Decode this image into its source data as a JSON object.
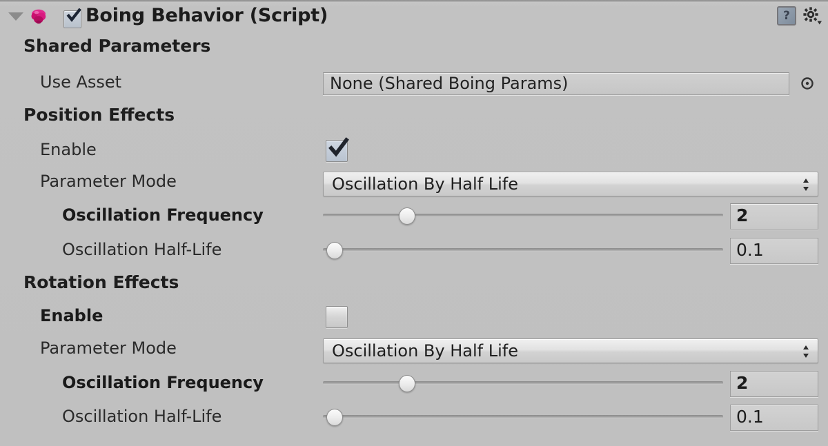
{
  "header": {
    "title": "Boing Behavior (Script)",
    "enabled_checkbox": true,
    "foldout_expanded": true,
    "script_icon": "unity-script-icon",
    "help_icon_glyph": "?",
    "gear_icon": "settings-gear-icon",
    "accent_color": "#d6197f",
    "panel_bg": "#c0c0c0"
  },
  "sections": {
    "shared_parameters": {
      "title": "Shared Parameters",
      "use_asset": {
        "label": "Use Asset",
        "value": "None (Shared Boing Params)",
        "picker_icon": "target-select-icon"
      }
    },
    "position_effects": {
      "title": "Position Effects",
      "enable": {
        "label": "Enable",
        "checked": true,
        "bold": false
      },
      "parameter_mode": {
        "label": "Parameter Mode",
        "value": "Oscillation By Half Life"
      },
      "oscillation_frequency": {
        "label": "Oscillation Frequency",
        "value": "2",
        "bold": true,
        "slider_pct": 21
      },
      "oscillation_half_life": {
        "label": "Oscillation Half-Life",
        "value": "0.1",
        "bold": false,
        "slider_pct": 3
      }
    },
    "rotation_effects": {
      "title": "Rotation Effects",
      "enable": {
        "label": "Enable",
        "checked": false,
        "bold": true
      },
      "parameter_mode": {
        "label": "Parameter Mode",
        "value": "Oscillation By Half Life"
      },
      "oscillation_frequency": {
        "label": "Oscillation Frequency",
        "value": "2",
        "bold": true,
        "slider_pct": 21
      },
      "oscillation_half_life": {
        "label": "Oscillation Half-Life",
        "value": "0.1",
        "bold": false,
        "slider_pct": 3
      }
    }
  }
}
